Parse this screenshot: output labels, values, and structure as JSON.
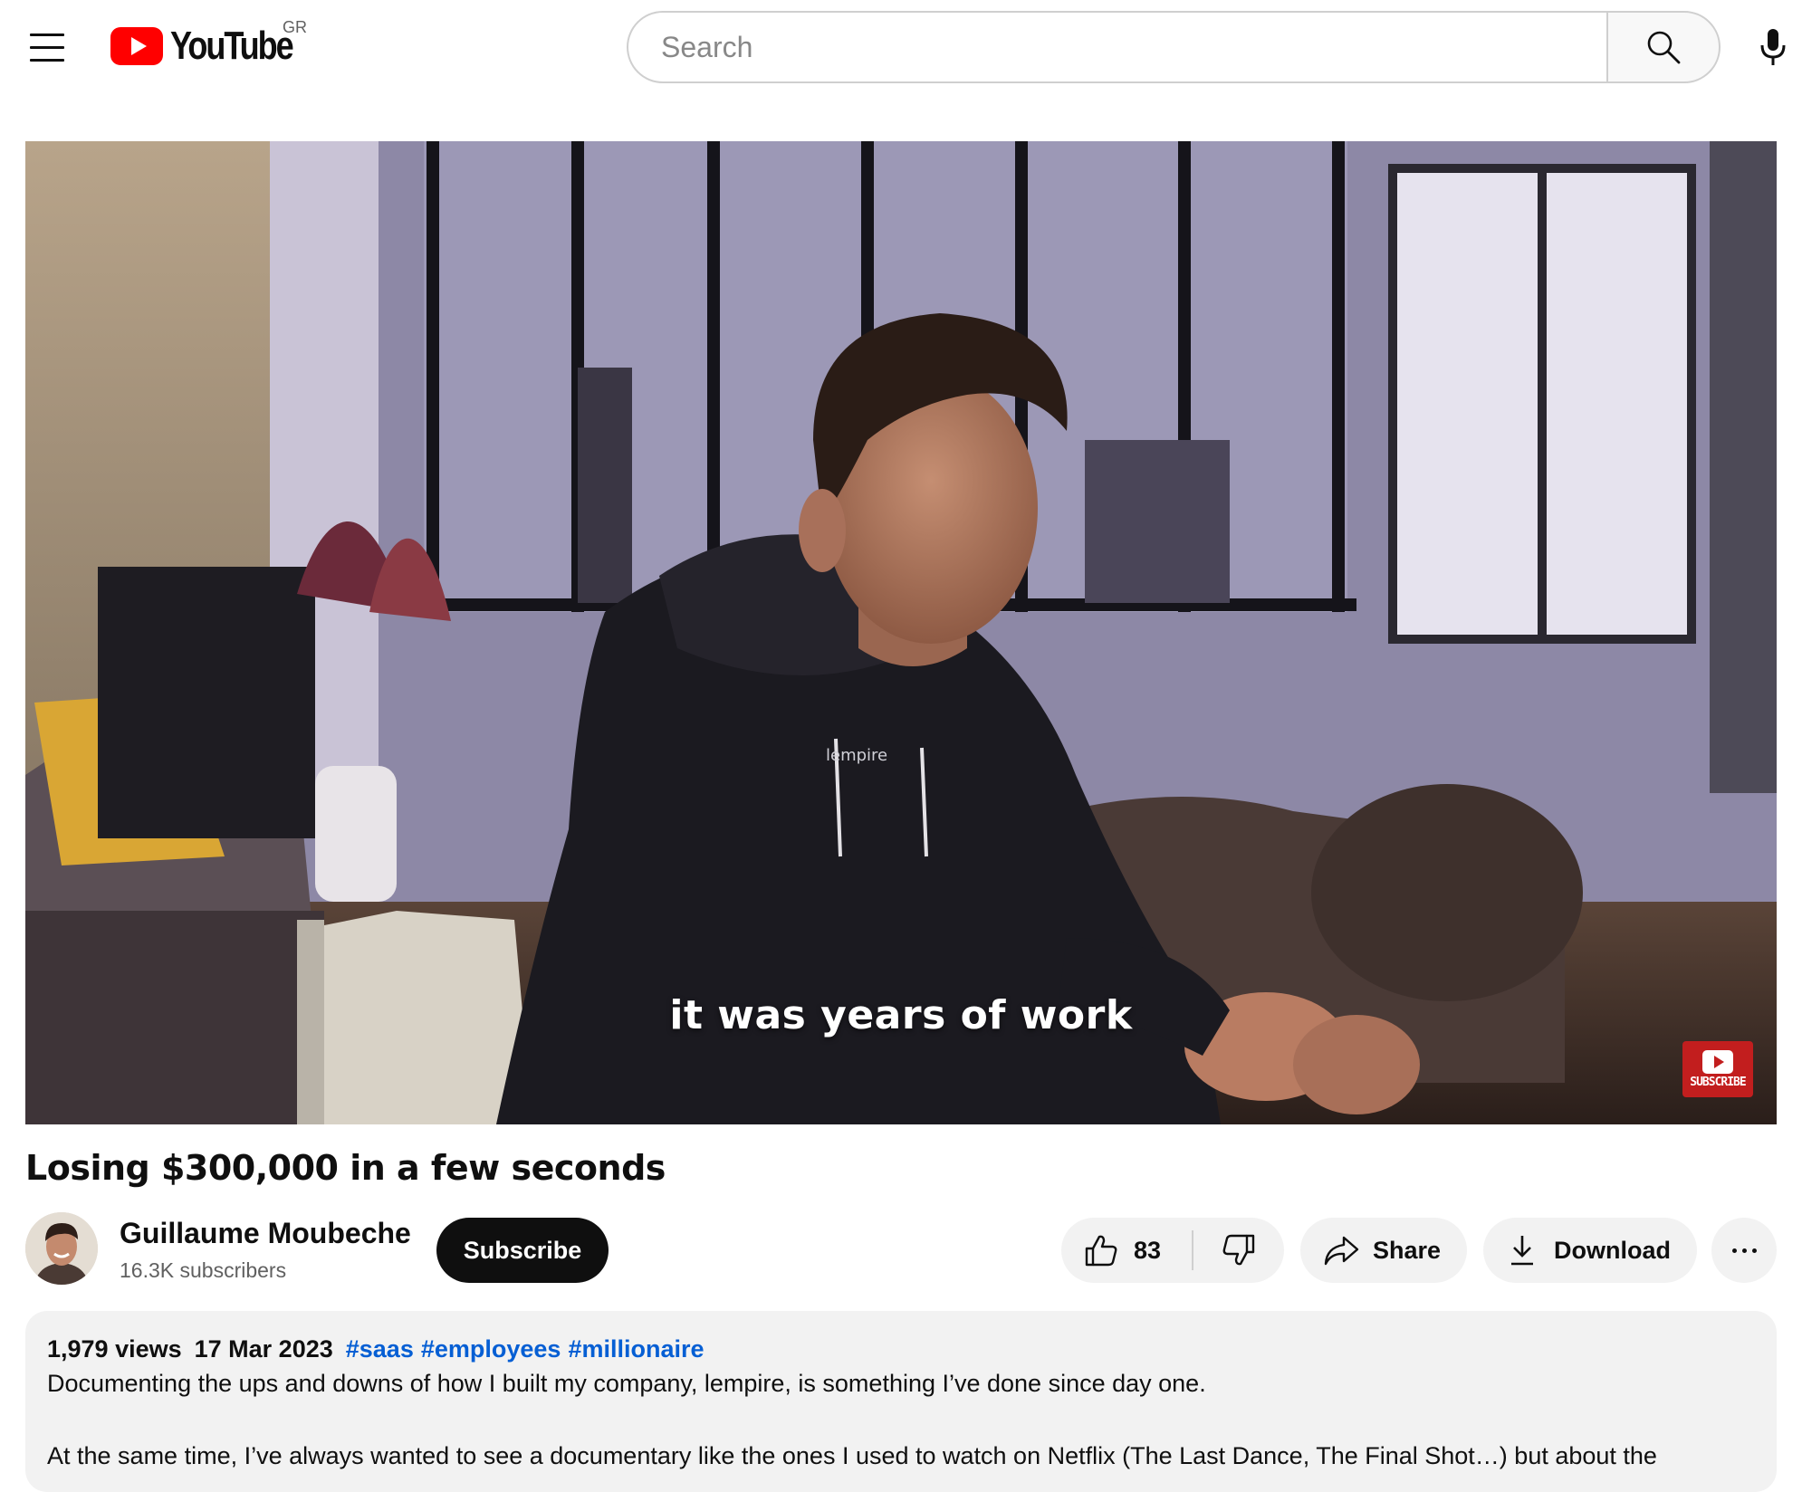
{
  "masthead": {
    "logo_text": "YouTube",
    "country_code": "GR",
    "search_placeholder": "Search",
    "icons": {
      "menu": "hamburger-icon",
      "search": "search-icon",
      "mic": "microphone-icon"
    }
  },
  "player": {
    "caption": "it was years of work",
    "hoodie_text": "lempire",
    "watermark_label": "SUBSCRIBE"
  },
  "video": {
    "title": "Losing $300,000 in a few seconds"
  },
  "owner": {
    "channel_name": "Guillaume Moubeche",
    "subscribers": "16.3K subscribers",
    "subscribe_label": "Subscribe"
  },
  "actions": {
    "like_count": "83",
    "share_label": "Share",
    "download_label": "Download",
    "icons": {
      "like": "thumbs-up-icon",
      "dislike": "thumbs-down-icon",
      "share": "share-arrow-icon",
      "download": "download-icon",
      "more": "more-horizontal-icon"
    }
  },
  "description": {
    "views": "1,979 views",
    "date": "17 Mar 2023",
    "hashtags": [
      "#saas",
      "#employees",
      "#millionaire"
    ],
    "lines": [
      "Documenting the ups and downs of how I built my company, lempire, is something I’ve done since day one.",
      "At the same time, I’ve always wanted to see a documentary like the ones I used to watch on Netflix (The Last Dance, The Final Shot…) but about the"
    ]
  },
  "colors": {
    "brand_red": "#ff0000",
    "link_blue": "#065fd4",
    "text_primary": "#0f0f0f",
    "text_secondary": "#606060",
    "chip_bg": "#f2f2f2"
  }
}
